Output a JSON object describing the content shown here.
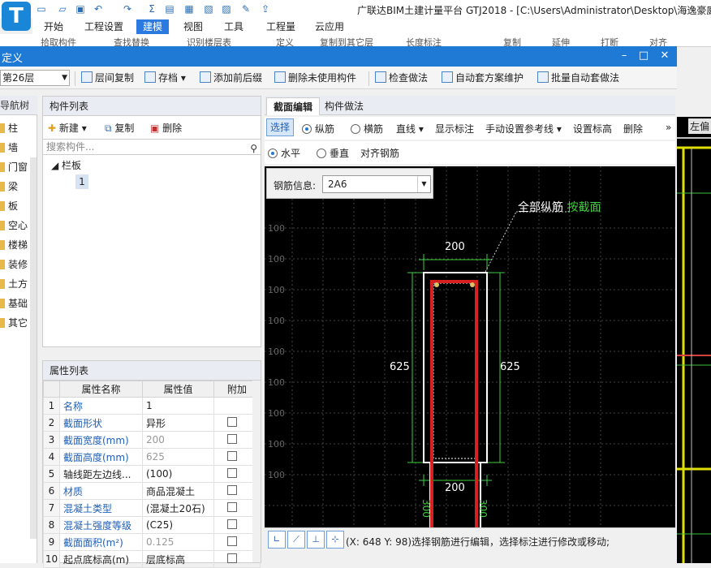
{
  "app": {
    "logo": "T",
    "title": "广联达BIM土建计量平台 GTJ2018 - [C:\\Users\\Administrator\\Desktop\\海逸豪庭"
  },
  "ribbon": {
    "tabs": [
      "开始",
      "工程设置",
      "建模",
      "视图",
      "工具",
      "工程量",
      "云应用"
    ],
    "active_tab": "建模",
    "strip": [
      "拾取构件",
      "查找替换",
      "识别楼层表",
      "定义",
      "复制到其它层",
      "长度标注",
      "复制",
      "延伸",
      "打断",
      "对齐"
    ]
  },
  "dialog": {
    "title": "定义",
    "floor": "第26层",
    "toolbar": [
      "层间复制",
      "存档",
      "添加前后缀",
      "删除未使用构件",
      "检查做法",
      "自动套方案维护",
      "批量自动套做法"
    ]
  },
  "nav": {
    "header": "导航树",
    "items": [
      "柱",
      "墙",
      "门窗",
      "梁",
      "板",
      "空心",
      "楼梯",
      "装修",
      "土方",
      "基础",
      "其它"
    ]
  },
  "component_list": {
    "header": "构件列表",
    "new_label": "新建",
    "copy_label": "复制",
    "delete_label": "删除",
    "search_placeholder": "搜索构件...",
    "tree_root": "栏板",
    "tree_child": "1"
  },
  "properties": {
    "header": "属性列表",
    "columns": [
      "属性名称",
      "属性值",
      "附加"
    ],
    "rows": [
      {
        "n": "1",
        "name": "名称",
        "value": "1",
        "blue": true,
        "grey": false,
        "cb": false
      },
      {
        "n": "2",
        "name": "截面形状",
        "value": "异形",
        "blue": true,
        "grey": false,
        "cb": true
      },
      {
        "n": "3",
        "name": "截面宽度(mm)",
        "value": "200",
        "blue": true,
        "grey": true,
        "cb": true
      },
      {
        "n": "4",
        "name": "截面高度(mm)",
        "value": "625",
        "blue": true,
        "grey": true,
        "cb": true
      },
      {
        "n": "5",
        "name": "轴线距左边线...",
        "value": "(100)",
        "blue": false,
        "grey": false,
        "cb": true
      },
      {
        "n": "6",
        "name": "材质",
        "value": "商品混凝土",
        "blue": true,
        "grey": false,
        "cb": true
      },
      {
        "n": "7",
        "name": "混凝土类型",
        "value": "(混凝土20石)",
        "blue": true,
        "grey": false,
        "cb": true
      },
      {
        "n": "8",
        "name": "混凝土强度等级",
        "value": "(C25)",
        "blue": true,
        "grey": false,
        "cb": true
      },
      {
        "n": "9",
        "name": "截面面积(m²)",
        "value": "0.125",
        "blue": true,
        "grey": true,
        "cb": true
      },
      {
        "n": "10",
        "name": "起点底标高(m)",
        "value": "层底标高",
        "blue": false,
        "grey": false,
        "cb": true
      }
    ]
  },
  "section_editor": {
    "tabs": [
      "截面编辑",
      "构件做法"
    ],
    "select_label": "选择",
    "long_rebar": "纵筋",
    "stirrup": "横筋",
    "line_label": "直线",
    "show_label": "显示标注",
    "manual_ref": "手动设置参考线",
    "set_elev": "设置标高",
    "delete_label": "删除",
    "horizontal": "水平",
    "vertical": "垂直",
    "align_rebar": "对齐钢筋",
    "rebar_info_label": "钢筋信息:",
    "rebar_info_value": "2A6",
    "annotation_main": "全部纵筋",
    "annotation_green": "按截面",
    "dim_width_top": "200",
    "dim_width_bottom": "200",
    "dim_height_left": "625",
    "dim_height_right": "625",
    "dim_300_left": "300",
    "dim_300_right": "300",
    "grid_label": "100"
  },
  "status": {
    "coord_text": "(X: 648 Y: 98)选择钢筋进行编辑，选择标注进行修改或移动;"
  },
  "background_cad": {
    "left_button": "左偏"
  }
}
